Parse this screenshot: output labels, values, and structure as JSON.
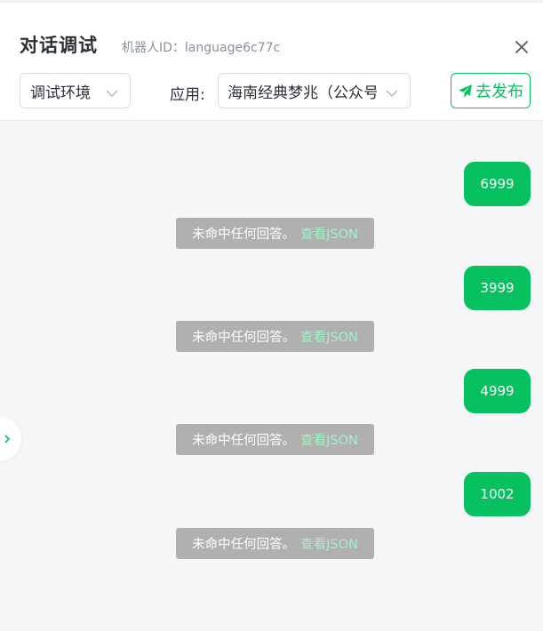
{
  "header": {
    "title": "对话调试",
    "bot_id_label": "机器人ID：language6c77c",
    "env_select_value": "调试环境",
    "app_label": "应用:",
    "app_select_value": "海南经典梦兆（公众号",
    "publish_label": "去发布"
  },
  "chat": {
    "messages": [
      {
        "user": "6999",
        "reply_text": "未命中任何回答。",
        "reply_link": "查看JSON"
      },
      {
        "user": "3999",
        "reply_text": "未命中任何回答。",
        "reply_link": "查看JSON"
      },
      {
        "user": "4999",
        "reply_text": "未命中任何回答。",
        "reply_link": "查看JSON"
      },
      {
        "user": "1002",
        "reply_text": "未命中任何回答。",
        "reply_link": "查看JSON"
      }
    ]
  },
  "icons": {
    "close": "close-icon",
    "chevron": "chevron-down-icon",
    "publish": "send-icon",
    "expand": "chevron-right-icon"
  },
  "colors": {
    "accent": "#07c160",
    "link_on_gray": "#a6efc8",
    "system_message_bg": "#b0b0b0",
    "chat_bg": "#f5f6f8"
  }
}
